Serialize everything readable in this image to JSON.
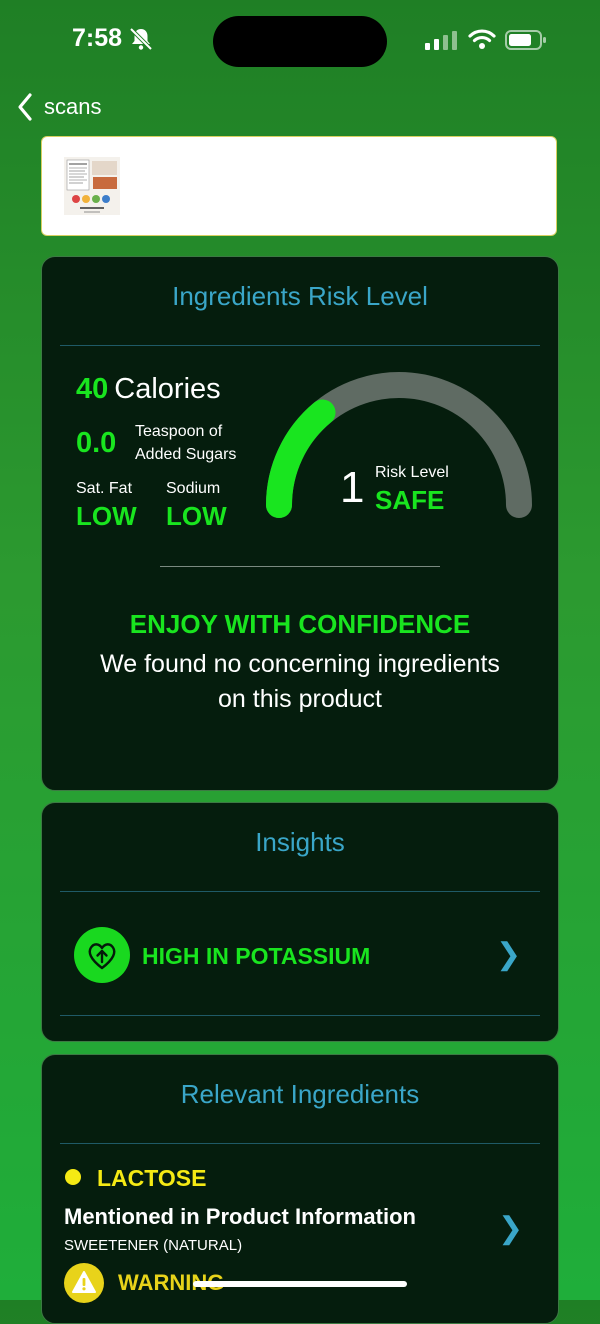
{
  "status_bar": {
    "time": "7:58"
  },
  "nav": {
    "back_label": "scans"
  },
  "risk_card": {
    "title": "Ingredients Risk Level",
    "calories_value": "40",
    "calories_label": "Calories",
    "sugar_value": "0.0",
    "sugar_label_line1": "Teaspoon of",
    "sugar_label_line2": "Added Sugars",
    "sat_fat_label": "Sat. Fat",
    "sat_fat_value": "LOW",
    "sodium_label": "Sodium",
    "sodium_value": "LOW",
    "gauge": {
      "risk_number": "1",
      "risk_label": "Risk Level",
      "risk_status": "SAFE",
      "fill_fraction": 0.28
    },
    "verdict_title": "ENJOY WITH CONFIDENCE",
    "verdict_line1": "We found no concerning ingredients",
    "verdict_line2": "on this product"
  },
  "insights_card": {
    "title": "Insights",
    "items": [
      {
        "label": "HIGH IN POTASSIUM",
        "icon": "heart-arrow-up-icon"
      }
    ]
  },
  "ingredients_card": {
    "title": "Relevant Ingredients",
    "items": [
      {
        "name": "LACTOSE",
        "dot_color": "#f5ea14",
        "source": "Mentioned in Product Information",
        "category": "SWEETENER (NATURAL)",
        "level": "WARNING"
      }
    ]
  },
  "colors": {
    "accent_green": "#19e51f",
    "accent_blue": "#3aa6c8",
    "warning_yellow": "#f5ea14"
  }
}
